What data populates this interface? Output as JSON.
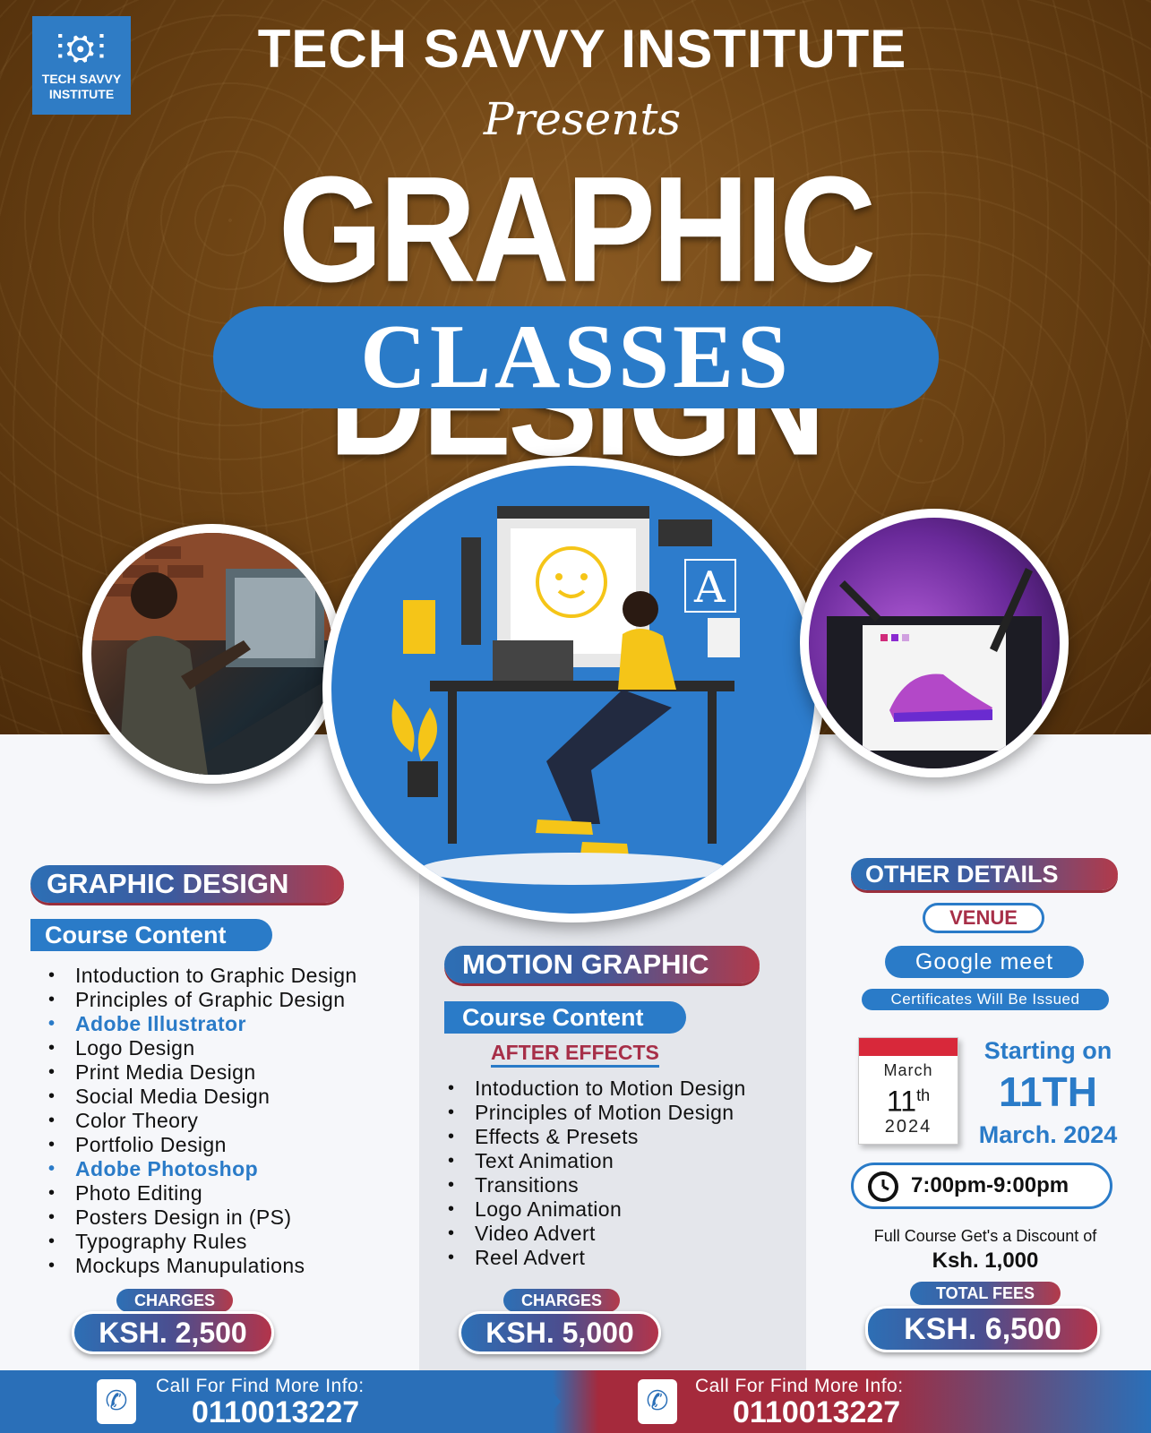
{
  "header": {
    "logo_mark": "⫶⚙⫶",
    "logo_text_line1": "TECH SAVVY",
    "logo_text_line2": "INSTITUTE",
    "institute_title": "TECH SAVVY INSTITUTE",
    "presents": "Presents",
    "headline": "GRAPHIC DESIGN",
    "classes": "CLASSES"
  },
  "graphic_design": {
    "title": "GRAPHIC DESIGN",
    "course_content_label": "Course Content",
    "items": [
      {
        "text": "Intoduction to Graphic Design",
        "highlight": false
      },
      {
        "text": "Principles of Graphic Design",
        "highlight": false
      },
      {
        "text": "Adobe Illustrator",
        "highlight": true
      },
      {
        "text": "Logo Design",
        "highlight": false
      },
      {
        "text": "Print Media Design",
        "highlight": false
      },
      {
        "text": "Social Media Design",
        "highlight": false
      },
      {
        "text": "Color Theory",
        "highlight": false
      },
      {
        "text": "Portfolio Design",
        "highlight": false
      },
      {
        "text": "Adobe Photoshop",
        "highlight": true
      },
      {
        "text": "Photo Editing",
        "highlight": false
      },
      {
        "text": "Posters Design in (PS)",
        "highlight": false
      },
      {
        "text": "Typography Rules",
        "highlight": false
      },
      {
        "text": "Mockups Manupulations",
        "highlight": false
      }
    ],
    "charges_label": "CHARGES",
    "price": "KSH. 2,500"
  },
  "motion_graphic": {
    "title": "MOTION GRAPHIC",
    "course_content_label": "Course Content",
    "software": "AFTER EFFECTS",
    "items": [
      {
        "text": "Intoduction to Motion Design"
      },
      {
        "text": "Principles of Motion Design"
      },
      {
        "text": "Effects & Presets"
      },
      {
        "text": "Text Animation"
      },
      {
        "text": "Transitions"
      },
      {
        "text": "Logo Animation"
      },
      {
        "text": "Video Advert"
      },
      {
        "text": "Reel Advert"
      }
    ],
    "charges_label": "CHARGES",
    "price": "KSH. 5,000"
  },
  "other_details": {
    "title": "OTHER DETAILS",
    "venue_label": "VENUE",
    "venue": "Google meet",
    "certificates": "Certificates Will Be Issued",
    "calendar": {
      "month": "March",
      "day": "11",
      "suffix": "th",
      "year": "2024"
    },
    "starting_on": "Starting on",
    "start_day": "11TH",
    "start_month_year": "March. 2024",
    "time": "7:00pm-9:00pm",
    "discount_text": "Full Course Get's a Discount of",
    "discount_amount": "Ksh. 1,000",
    "total_label": "TOTAL FEES",
    "total_price": "KSH. 6,500"
  },
  "footer": {
    "left_label": "Call For Find More Info:",
    "left_number": "0110013227",
    "right_label": "Call For Find More Info:",
    "right_number": "0110013227",
    "phone_icon": "✆"
  },
  "colors": {
    "brand_blue": "#2a7bc8",
    "accent_red": "#a52a3c",
    "brown_bg": "#6e4414"
  }
}
